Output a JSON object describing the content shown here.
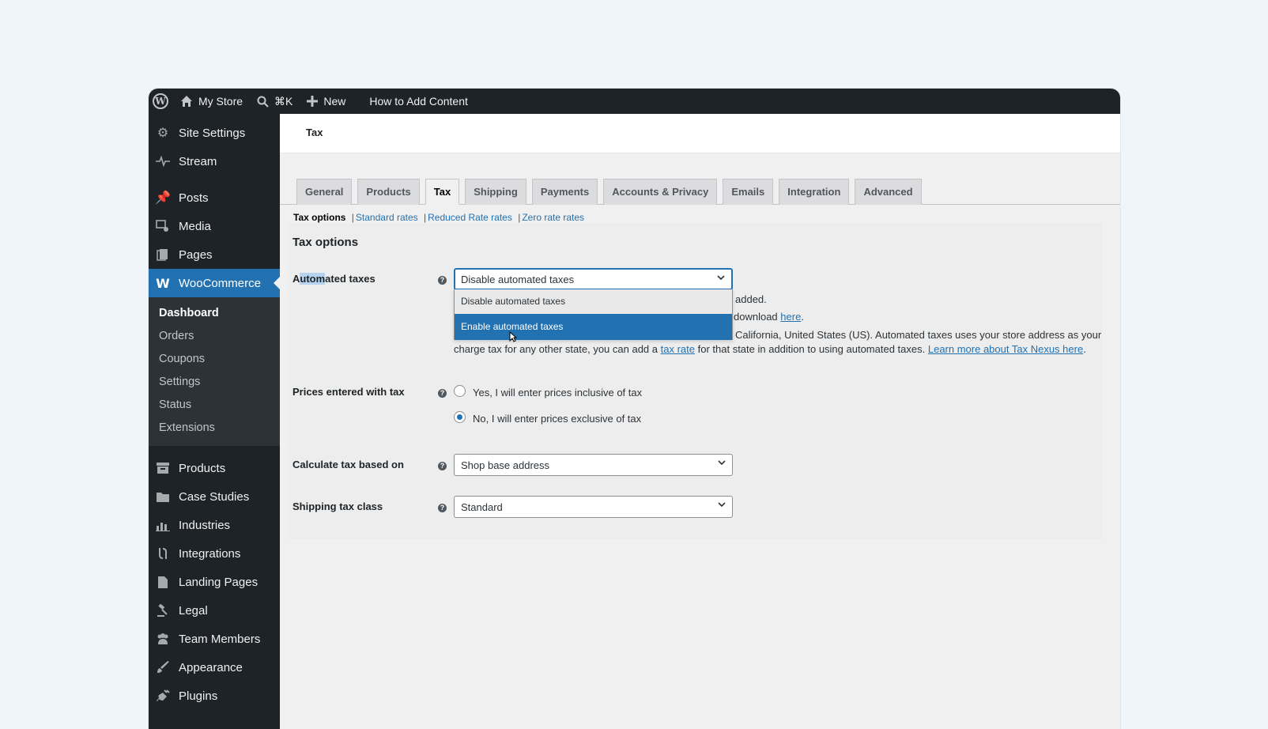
{
  "admin_bar": {
    "wp_logo": "wordpress-logo-icon",
    "site_name": "My Store",
    "search_shortcut": "⌘K",
    "new_label": "New",
    "help_link": "How to Add Content"
  },
  "sidebar": {
    "top_items": [
      {
        "label": "Site Settings",
        "icon": "gear-icon"
      },
      {
        "label": "Stream",
        "icon": "pulse-icon"
      }
    ],
    "main_items": [
      {
        "label": "Posts",
        "icon": "pin-icon"
      },
      {
        "label": "Media",
        "icon": "media-icon"
      },
      {
        "label": "Pages",
        "icon": "pages-icon"
      }
    ],
    "current": {
      "label": "WooCommerce",
      "icon": "woo-icon"
    },
    "submenu": [
      "Dashboard",
      "Orders",
      "Coupons",
      "Settings",
      "Status",
      "Extensions"
    ],
    "lower_items": [
      {
        "label": "Products",
        "icon": "archive-icon"
      },
      {
        "label": "Case Studies",
        "icon": "folder-icon"
      },
      {
        "label": "Industries",
        "icon": "chart-icon"
      },
      {
        "label": "Integrations",
        "icon": "plug-icon"
      },
      {
        "label": "Landing Pages",
        "icon": "document-icon"
      },
      {
        "label": "Legal",
        "icon": "gavel-icon"
      },
      {
        "label": "Team Members",
        "icon": "team-icon"
      },
      {
        "label": "Appearance",
        "icon": "brush-icon"
      },
      {
        "label": "Plugins",
        "icon": "plugin-icon"
      }
    ]
  },
  "page": {
    "breadcrumb": "Tax",
    "tabs": [
      "General",
      "Products",
      "Tax",
      "Shipping",
      "Payments",
      "Accounts & Privacy",
      "Emails",
      "Integration",
      "Advanced"
    ],
    "active_tab": "Tax",
    "subsections": {
      "current": "Tax options",
      "links": [
        "Standard rates",
        "Reduced Rate rates",
        "Zero rate rates"
      ]
    },
    "section_title": "Tax options"
  },
  "fields": {
    "automated_taxes": {
      "label": "Automated taxes",
      "label_highlight": "utom",
      "selected": "Disable automated taxes",
      "options": [
        "Disable automated taxes",
        "Enable automated taxes"
      ],
      "desc_line1_end": "added.",
      "desc_line2_text": "download",
      "desc_line2_link": "here",
      "desc_line3": "California, United States (US). Automated taxes uses your store address as your",
      "desc_line4_pre": "charge tax for any other state, you can add a",
      "desc_line4_link1": "tax rate",
      "desc_line4_mid": "for that state in addition to using automated taxes.",
      "desc_line4_link2": "Learn more about Tax Nexus here"
    },
    "prices_entered": {
      "label": "Prices entered with tax",
      "option_yes": "Yes, I will enter prices inclusive of tax",
      "option_no": "No, I will enter prices exclusive of tax",
      "selected": "no"
    },
    "calculate_based_on": {
      "label": "Calculate tax based on",
      "value": "Shop base address"
    },
    "shipping_tax_class": {
      "label": "Shipping tax class",
      "value": "Standard"
    }
  },
  "colors": {
    "admin_dark": "#1d2327",
    "accent_blue": "#2271b1",
    "submenu_bg": "#2c3338"
  }
}
